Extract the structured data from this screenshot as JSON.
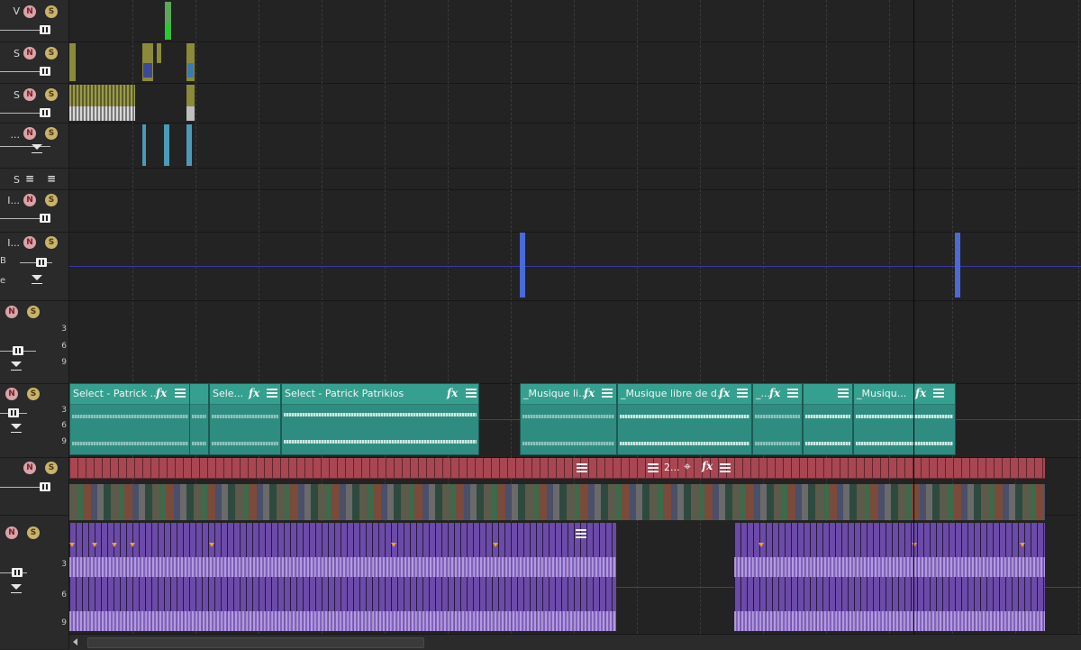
{
  "tracks": [
    {
      "name": "V",
      "mute_label": "N",
      "solo_label": "S"
    },
    {
      "name": "S",
      "mute_label": "N",
      "solo_label": "S"
    },
    {
      "name": "S",
      "mute_label": "N",
      "solo_label": "S"
    },
    {
      "name": "...",
      "mute_label": "N",
      "solo_label": "S"
    },
    {
      "name": "S"
    },
    {
      "name": "I...",
      "mute_label": "N",
      "solo_label": "S"
    },
    {
      "name": "I...",
      "sub1": "B",
      "sub2": "e",
      "mute_label": "N",
      "solo_label": "S"
    },
    {
      "mute_label": "N",
      "solo_label": "S",
      "db": [
        "3",
        "6",
        "9"
      ]
    },
    {
      "mute_label": "N",
      "solo_label": "S",
      "db": [
        "3",
        "6",
        "9"
      ]
    },
    {
      "mute_label": "N",
      "solo_label": "S"
    },
    {
      "mute_label": "N",
      "solo_label": "S",
      "db": [
        "3",
        "6",
        "9"
      ]
    }
  ],
  "audio_clips": [
    {
      "title": "Select - Patrick ..."
    },
    {
      "title": "Sele..."
    },
    {
      "title": "Select - Patrick Patrikios"
    },
    {
      "title": "_Musique li..."
    },
    {
      "title": "_Musique libre de d..."
    },
    {
      "title": "_..."
    },
    {
      "title": ""
    },
    {
      "title": "_Musiqu..."
    }
  ],
  "video_track": {
    "clip_label": "2..."
  },
  "colors": {
    "audio_clip": "#2f8c80",
    "video_title": "#a84652",
    "purple_audio": "#6b4aa8",
    "envelope": "#3a3aa8"
  }
}
